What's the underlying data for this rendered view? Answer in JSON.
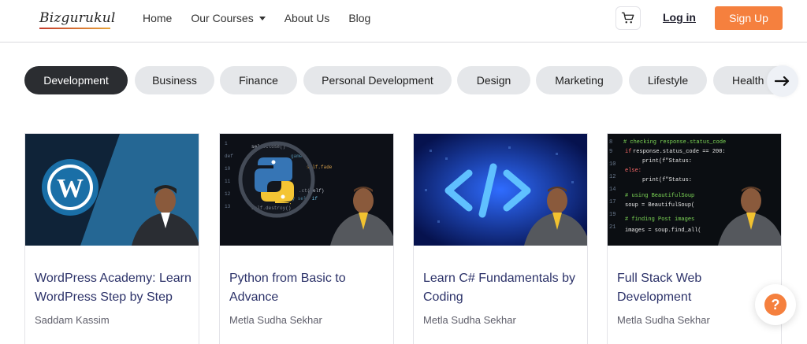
{
  "header": {
    "logo_text": "Bizgurukul",
    "nav": [
      {
        "label": "Home"
      },
      {
        "label": "Our Courses",
        "has_dropdown": true
      },
      {
        "label": "About Us"
      },
      {
        "label": "Blog"
      }
    ],
    "cart_icon": "cart-icon",
    "login_label": "Log in",
    "signup_label": "Sign Up"
  },
  "categories": [
    {
      "label": "Development",
      "active": true
    },
    {
      "label": "Business"
    },
    {
      "label": "Finance"
    },
    {
      "label": "Personal Development"
    },
    {
      "label": "Design"
    },
    {
      "label": "Marketing"
    },
    {
      "label": "Lifestyle"
    },
    {
      "label": "Health"
    }
  ],
  "courses": [
    {
      "title": "WordPress Academy: Learn WordPress Step by Step",
      "author": "Saddam Kassim"
    },
    {
      "title": "Python from Basic to Advance",
      "author": "Metla Sudha Sekhar"
    },
    {
      "title": "Learn C# Fundamentals by Coding",
      "author": "Metla Sudha Sekhar"
    },
    {
      "title": "Full Stack Web Development",
      "author": "Metla Sudha Sekhar"
    }
  ],
  "colors": {
    "accent": "#f5803e",
    "active_pill": "#2b2d31",
    "pill": "#e5e7ea",
    "course_title": "#2c3269"
  }
}
